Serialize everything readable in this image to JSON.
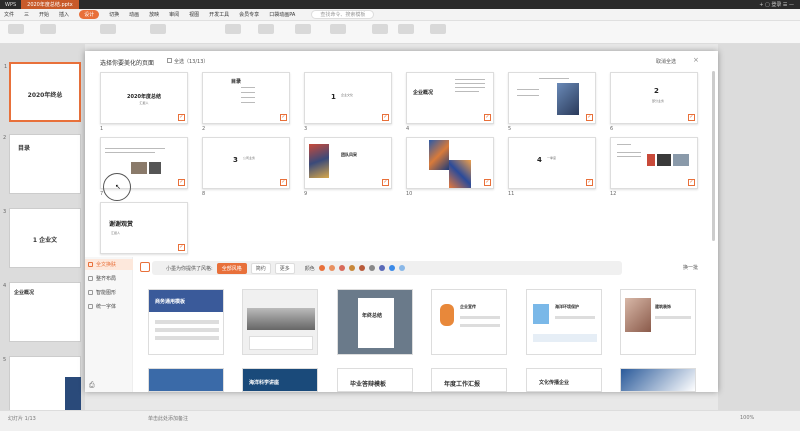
{
  "titlebar": {
    "app_tab": "WPS",
    "doc_tab": "2020年度总结.pptx",
    "right_text": "+ ▢ 登录 ☰ —"
  },
  "menubar": {
    "items": [
      "文件",
      "三",
      "开始",
      "插入",
      "设计",
      "切换",
      "动画",
      "放映",
      "审阅",
      "视图",
      "开发工具",
      "会员专享",
      "口袋动画PA"
    ],
    "active_index": 4,
    "search_placeholder": "查找命令、搜索模板"
  },
  "left_panel": {
    "slides": [
      {
        "num": "1",
        "title": "2020年终总"
      },
      {
        "num": "2",
        "title": "目录"
      },
      {
        "num": "3",
        "title": "1  企业文"
      },
      {
        "num": "4",
        "title": "企业概况"
      },
      {
        "num": "5",
        "title": ""
      }
    ]
  },
  "dialog": {
    "title": "选择你要美化的页面",
    "select_all": "全选（13/13）",
    "cancel_select": "取消全选",
    "slides": [
      {
        "num": "1",
        "title": "2020年度总结",
        "sub": "汇报人"
      },
      {
        "num": "2",
        "title": "目录",
        "sub": ""
      },
      {
        "num": "3",
        "title": "1",
        "sub": "企业文化"
      },
      {
        "num": "4",
        "title": "企业概况",
        "sub": ""
      },
      {
        "num": "5",
        "title": "",
        "sub": ""
      },
      {
        "num": "6",
        "title": "2",
        "sub": "部分业务"
      },
      {
        "num": "7",
        "title": "",
        "sub": ""
      },
      {
        "num": "8",
        "title": "3",
        "sub": "公司业务"
      },
      {
        "num": "9",
        "title": "团队风采",
        "sub": ""
      },
      {
        "num": "10",
        "title": "",
        "sub": ""
      },
      {
        "num": "11",
        "title": "4",
        "sub": "一季度"
      },
      {
        "num": "12",
        "title": "",
        "sub": ""
      },
      {
        "num": "13",
        "title": "谢谢观赏",
        "sub": "汇报人"
      }
    ],
    "sidebar": [
      {
        "label": "全文换肤",
        "active": true
      },
      {
        "label": "整齐布局",
        "active": false
      },
      {
        "label": "智能图形",
        "active": false
      },
      {
        "label": "统一字体",
        "active": false
      }
    ],
    "filter": {
      "label": "小墨为你提供了风格:",
      "style_pills": [
        "全部风格",
        "简约",
        "更多"
      ],
      "color_label": "颜色",
      "colors": [
        "#e8703a",
        "#e89060",
        "#d86a5a",
        "#c8883a",
        "#b85a3a",
        "#888888",
        "#5a6ab8",
        "#3a8ae8",
        "#8ab8e8"
      ],
      "change_label": "换一批"
    },
    "templates": [
      {
        "title": "商务通用模板"
      },
      {
        "title": ""
      },
      {
        "title": "年终总结"
      },
      {
        "title": "企业宣传"
      },
      {
        "title": "海洋环境保护"
      },
      {
        "title": "建筑装饰"
      }
    ],
    "templates_row2": [
      {
        "title": ""
      },
      {
        "title": "海洋科学讲座"
      },
      {
        "title": "毕业答辩模板"
      },
      {
        "title": "年度工作汇报"
      },
      {
        "title": "文化传播企业"
      },
      {
        "title": ""
      }
    ]
  },
  "statusbar": {
    "left": "幻灯片 1/13",
    "mid": "单击此处添加备注",
    "right": "100%"
  }
}
